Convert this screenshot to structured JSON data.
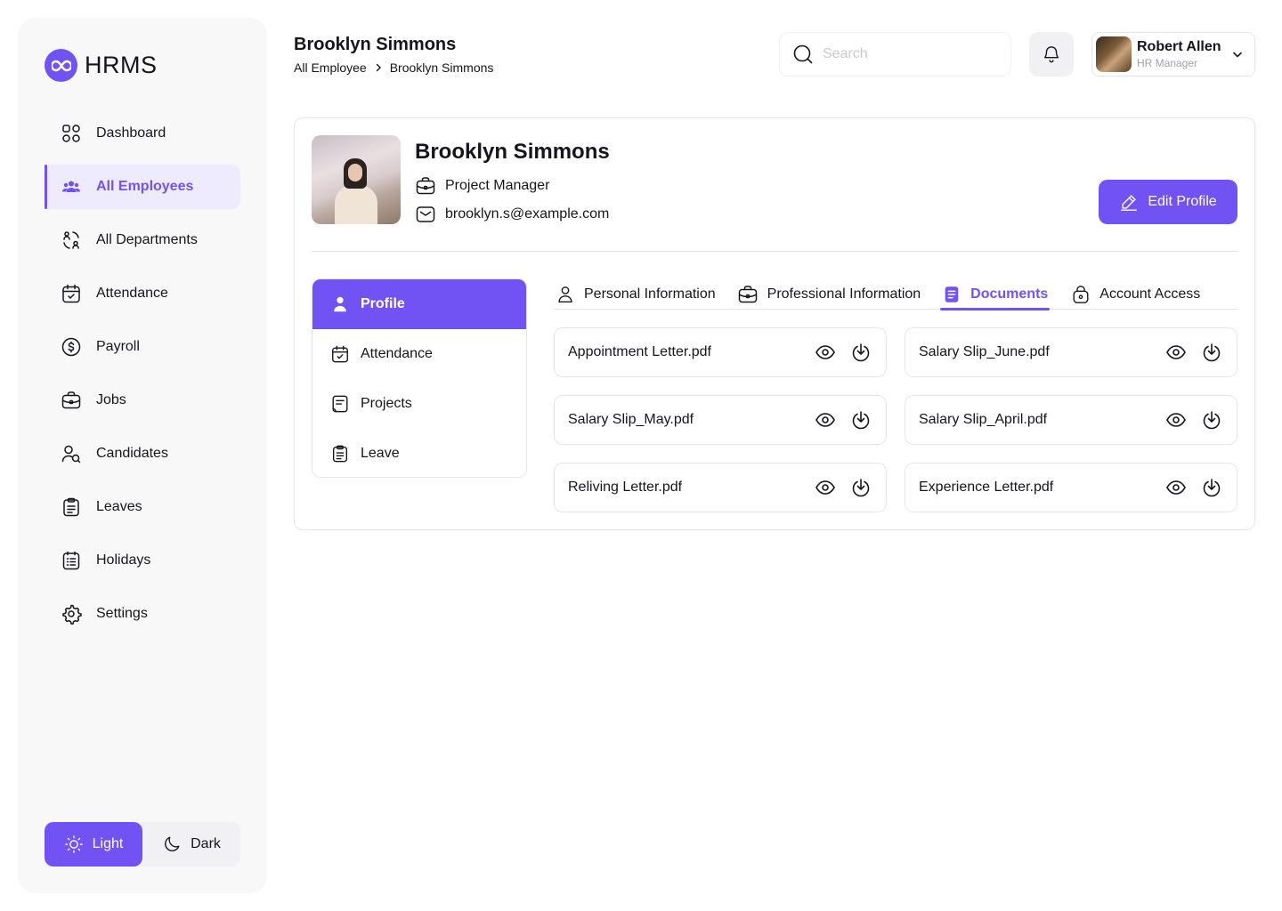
{
  "brand": {
    "name": "HRMS",
    "accent": "#7152F3"
  },
  "sidebar": {
    "items": [
      {
        "label": "Dashboard",
        "icon": "dashboard-icon"
      },
      {
        "label": "All Employees",
        "icon": "users-icon",
        "active": true
      },
      {
        "label": "All Departments",
        "icon": "departments-icon"
      },
      {
        "label": "Attendance",
        "icon": "calendar-check-icon"
      },
      {
        "label": "Payroll",
        "icon": "dollar-circle-icon"
      },
      {
        "label": "Jobs",
        "icon": "briefcase-icon"
      },
      {
        "label": "Candidates",
        "icon": "candidates-icon"
      },
      {
        "label": "Leaves",
        "icon": "clipboard-icon"
      },
      {
        "label": "Holidays",
        "icon": "calendar-list-icon"
      },
      {
        "label": "Settings",
        "icon": "gear-icon"
      }
    ],
    "theme": {
      "light": "Light",
      "dark": "Dark",
      "selected": "Light"
    }
  },
  "header": {
    "title": "Brooklyn Simmons",
    "breadcrumb": [
      "All Employee",
      "Brooklyn Simmons"
    ],
    "search_placeholder": "Search",
    "user": {
      "name": "Robert Allen",
      "role": "HR Manager"
    }
  },
  "profile": {
    "name": "Brooklyn Simmons",
    "role": "Project Manager",
    "email": "brooklyn.s@example.com",
    "edit_label": "Edit Profile"
  },
  "side_tabs": [
    {
      "label": "Profile",
      "icon": "user-icon",
      "active": true
    },
    {
      "label": "Attendance",
      "icon": "calendar-check-icon"
    },
    {
      "label": "Projects",
      "icon": "projects-icon"
    },
    {
      "label": "Leave",
      "icon": "clipboard-icon"
    }
  ],
  "tabs": [
    {
      "label": "Personal Information",
      "icon": "user-icon"
    },
    {
      "label": "Professional Information",
      "icon": "briefcase-icon"
    },
    {
      "label": "Documents",
      "icon": "document-icon",
      "active": true
    },
    {
      "label": "Account Access",
      "icon": "lock-icon"
    }
  ],
  "documents": [
    "Appointment Letter.pdf",
    "Salary Slip_June.pdf",
    "Salary Slip_May.pdf",
    "Salary Slip_April.pdf",
    "Reliving Letter.pdf",
    "Experience Letter.pdf"
  ]
}
